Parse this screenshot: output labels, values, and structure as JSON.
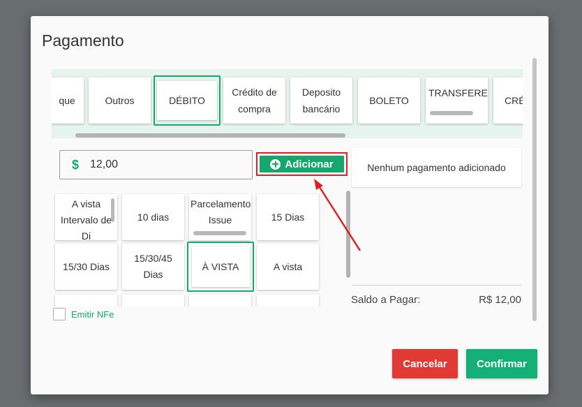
{
  "dialog": {
    "title": "Pagamento"
  },
  "payment_methods": [
    {
      "label": "que"
    },
    {
      "label": "Outros"
    },
    {
      "label": "DÉBITO",
      "selected": true
    },
    {
      "label": "Crédito de compra"
    },
    {
      "label": "Deposito bancário"
    },
    {
      "label": "BOLETO"
    },
    {
      "label": "TRANSFEREN"
    },
    {
      "label": "CRÉ"
    }
  ],
  "amount": {
    "currency_symbol": "$",
    "value": "12,00"
  },
  "add_button": {
    "label": "Adicionar",
    "icon": "plus-circle-icon"
  },
  "summary": {
    "empty_text": "Nenhum pagamento adicionado",
    "saldo_label": "Saldo a Pagar:",
    "saldo_value": "R$ 12,00"
  },
  "terms": [
    {
      "label": "A vista Intervalo de Di"
    },
    {
      "label": "10 dias"
    },
    {
      "label": "Parcelamento Issue"
    },
    {
      "label": "15 Dias"
    },
    {
      "label": "15/30 Dias"
    },
    {
      "label": "15/30/45 Dias"
    },
    {
      "label": "À VISTA",
      "selected": true
    },
    {
      "label": "A vista"
    }
  ],
  "nfe": {
    "label": "Emitir NFe",
    "checked": false
  },
  "footer": {
    "cancel_label": "Cancelar",
    "confirm_label": "Confirmar"
  },
  "colors": {
    "accent": "#14a86c",
    "cancel": "#e03a35",
    "highlight": "#e02020"
  }
}
